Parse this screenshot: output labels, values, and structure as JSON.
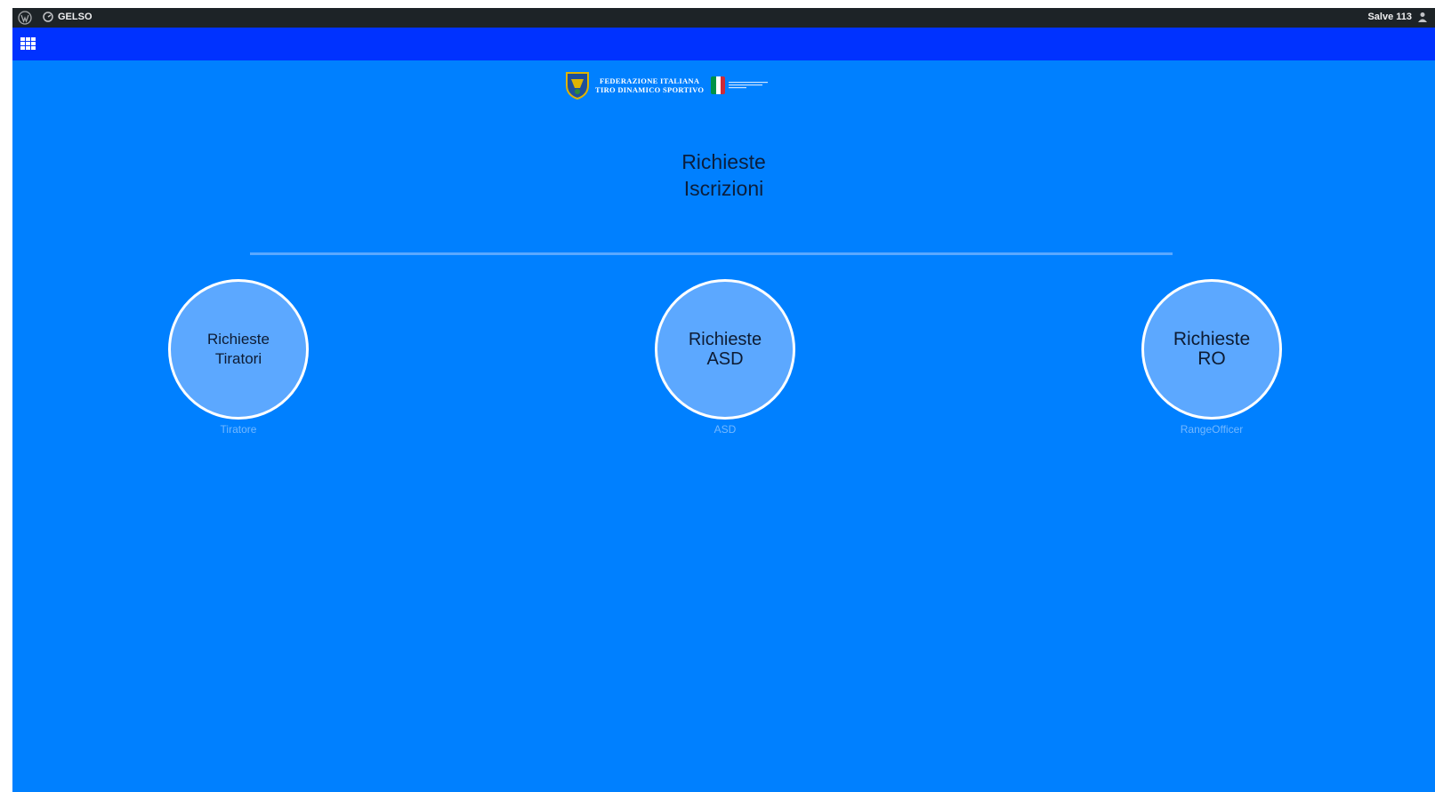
{
  "adminbar": {
    "wp_icon": "wordpress-icon",
    "site_icon": "dashboard-icon",
    "site_name": "GELSO",
    "greeting": "Salve 113",
    "user_icon": "user-icon"
  },
  "navbar": {
    "menu_icon": "grid-menu-icon"
  },
  "logo": {
    "line1": "FEDERAZIONE ITALIANA",
    "line2": "TIRO DINAMICO SPORTIVO",
    "flag_colors": [
      "#009246",
      "#ffffff",
      "#ce2b37"
    ]
  },
  "title": {
    "line1": "Richieste",
    "line2": "Iscrizioni"
  },
  "cards": [
    {
      "line1": "Richieste",
      "line2": "Tiratori",
      "caption": "Tiratore"
    },
    {
      "line1": "Richieste",
      "line2": "ASD",
      "caption": "ASD"
    },
    {
      "line1": "Richieste",
      "line2": "RO",
      "caption": "RangeOfficer"
    }
  ],
  "colors": {
    "background": "#0080ff",
    "navbar": "#0032ff",
    "adminbar": "#1d2327",
    "circle": "#5ca8ff"
  }
}
